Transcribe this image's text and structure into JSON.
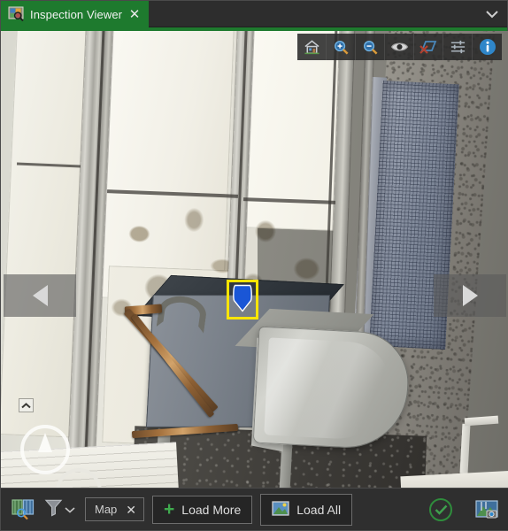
{
  "window": {
    "tab_label": "Inspection Viewer",
    "tab_icon": "inspection-image-search-icon",
    "tab_close": "✕",
    "collapse_chevron": "chevron-down-icon",
    "accent_color": "#1e7a2e"
  },
  "viewer_toolbar": {
    "buttons": [
      {
        "name": "home-icon",
        "tooltip": "Home"
      },
      {
        "name": "zoom-in-icon",
        "tooltip": "Zoom In"
      },
      {
        "name": "zoom-out-icon",
        "tooltip": "Zoom Out"
      },
      {
        "name": "eye-icon",
        "tooltip": "Show / Hide"
      },
      {
        "name": "clear-shape-icon",
        "tooltip": "Clear"
      },
      {
        "name": "sliders-icon",
        "tooltip": "Adjust"
      },
      {
        "name": "info-icon",
        "tooltip": "Information"
      }
    ]
  },
  "navigation": {
    "previous_label": "◀",
    "next_label": "▶"
  },
  "overlays": {
    "marker_name": "map-pin-marker",
    "marker_selected": true,
    "selection_color": "#ffe500",
    "marker_color": "#1a56d6",
    "compass_name": "compass-north-indicator",
    "collapse_name": "collapse-panel-button"
  },
  "bottom_toolbar": {
    "image_search_icon": "image-search-icon",
    "filter_icon": "filter-funnel-icon",
    "filter_chevron": "chevron-down-icon",
    "chip": {
      "label": "Map",
      "close": "✕"
    },
    "load_more": {
      "label": "Load More",
      "icon": "plus-icon",
      "plus": "+"
    },
    "load_all": {
      "label": "Load All",
      "icon": "image-icon"
    },
    "confirm": {
      "name": "confirm-check-icon",
      "color": "#2f8c3c"
    },
    "photo_tool": {
      "name": "photo-capture-icon"
    }
  }
}
